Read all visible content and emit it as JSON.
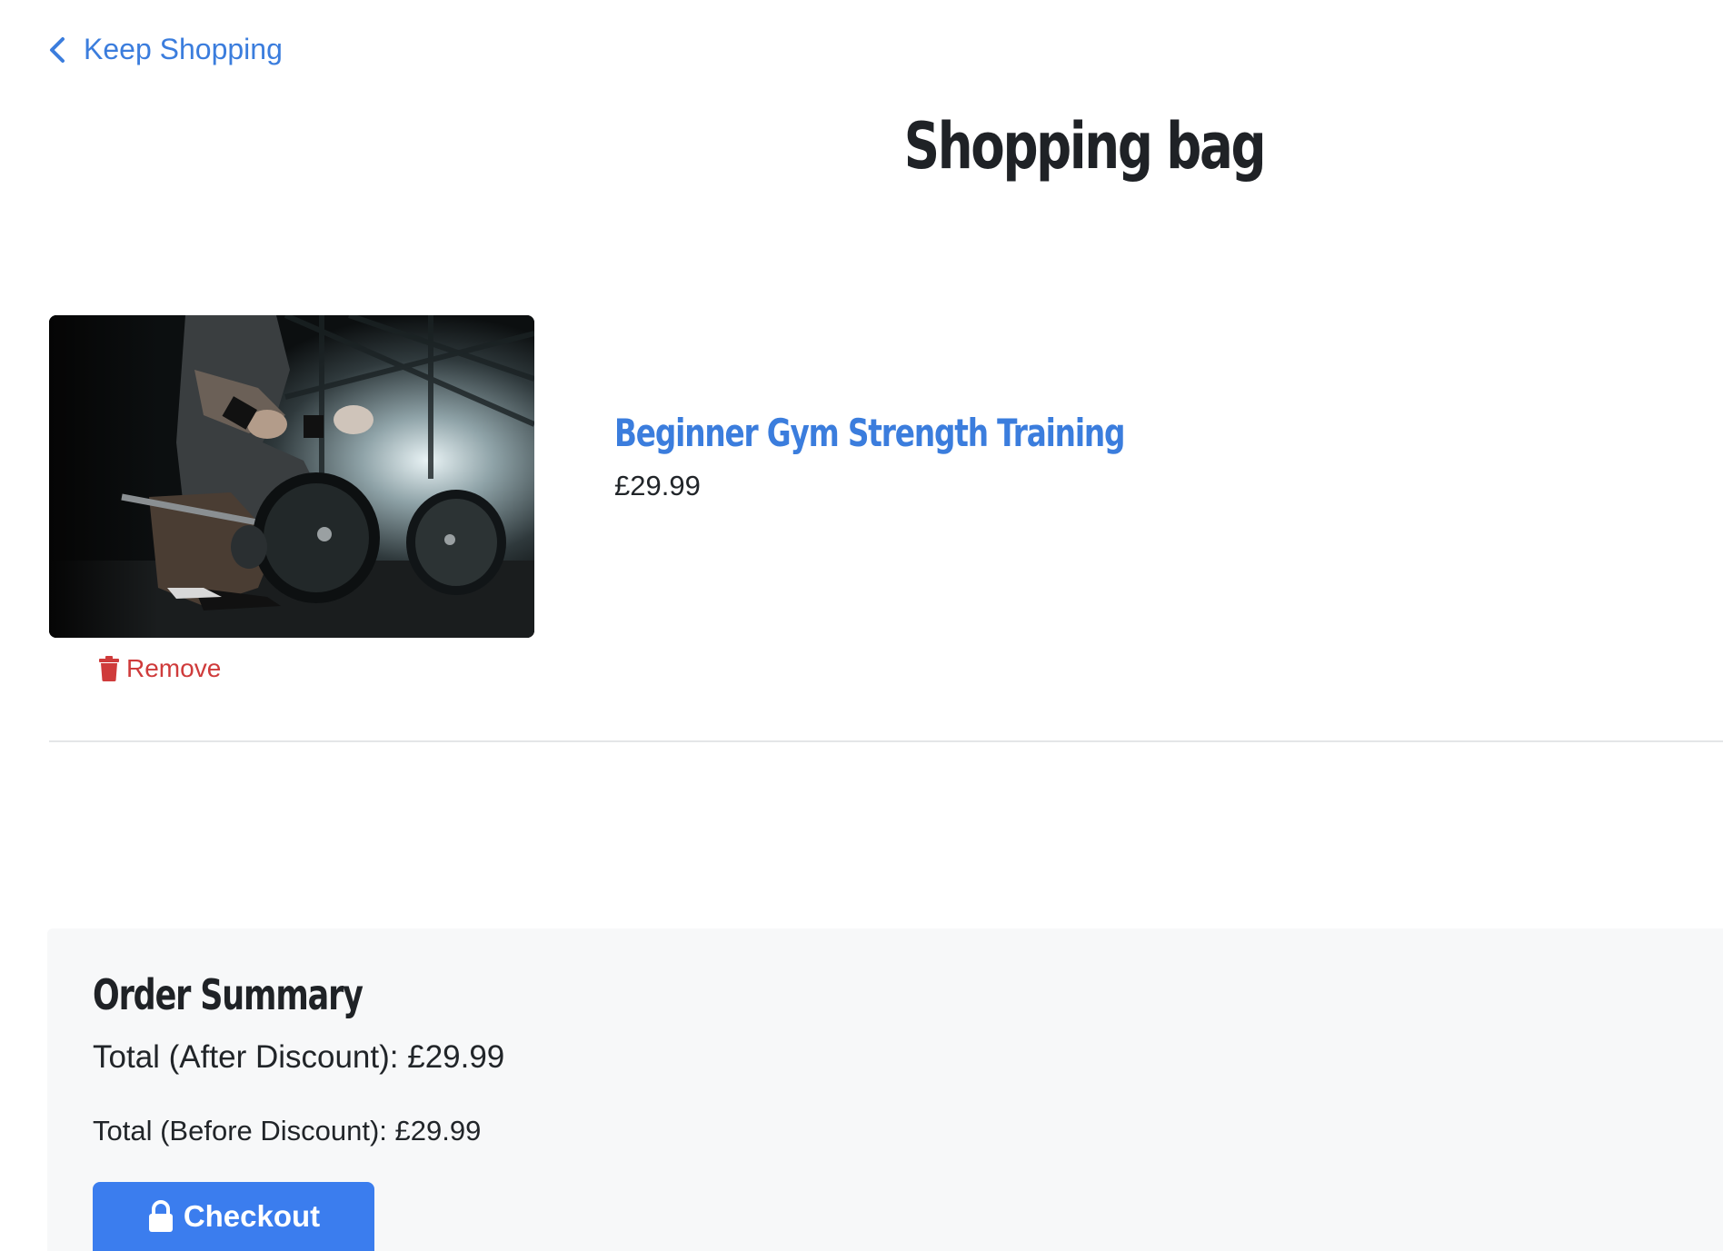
{
  "nav": {
    "keep_shopping_label": "Keep Shopping",
    "back_icon": "chevron-left-icon"
  },
  "page": {
    "title": "Shopping bag"
  },
  "cart": {
    "items": [
      {
        "name": "Beginner Gym Strength Training",
        "price": "£29.99",
        "image_description": "gym-barbell-photo",
        "remove_label": "Remove",
        "remove_icon": "trash-icon"
      }
    ]
  },
  "summary": {
    "title": "Order Summary",
    "total_after": "Total (After Discount): £29.99",
    "total_before": "Total (Before Discount): £29.99",
    "checkout_label": "Checkout",
    "checkout_icon": "lock-icon"
  },
  "colors": {
    "link_blue": "#3b7ddd",
    "button_blue": "#3b7dee",
    "danger_red": "#cf3b3b",
    "summary_bg": "#f7f8f9",
    "heading_dark": "#1f2226"
  }
}
